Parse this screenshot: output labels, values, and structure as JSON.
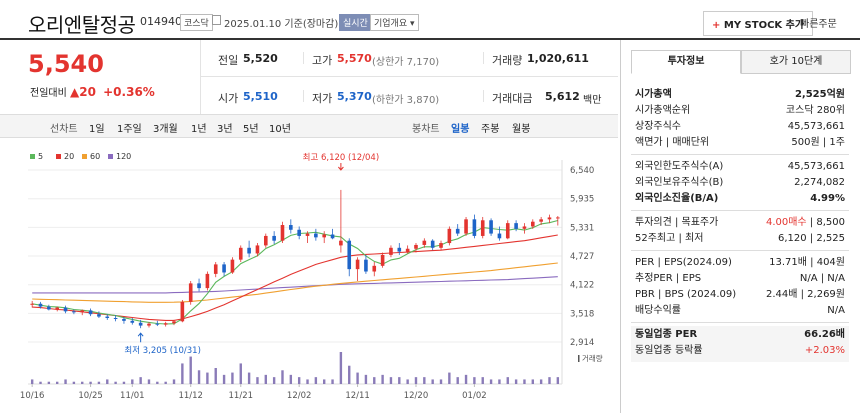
{
  "header": {
    "name": "오리엔탈정공",
    "code": "014940",
    "market": "코스닥",
    "date": "2025.01.10 기준(장마감)",
    "live": "실시간",
    "overview": "기업개요",
    "mystock": "MY STOCK 추가",
    "quick_order": "빠른주문"
  },
  "price": {
    "current": "5,540",
    "change_label": "전일대비",
    "change": "20",
    "change_pct": "+0.36%"
  },
  "quote": {
    "prev_label": "전일",
    "prev": "5,520",
    "high_label": "고가",
    "high": "5,570",
    "upper": "(상한가 7,170)",
    "volume_label": "거래량",
    "volume": "1,020,611",
    "open_label": "시가",
    "open": "5,510",
    "low_label": "저가",
    "low": "5,370",
    "lower": "(하한가 3,870)",
    "amount_label": "거래대금",
    "amount": "5,612",
    "amount_unit": "백만"
  },
  "periods": {
    "line_label": "선차트",
    "items": [
      "1일",
      "1주일",
      "3개월",
      "1년",
      "3년",
      "5년",
      "10년"
    ],
    "candle_label": "봉차트",
    "candle_items": [
      "일봉",
      "주봉",
      "월봉"
    ],
    "active": "일봉"
  },
  "chart_data": {
    "type": "candlestick",
    "legend": [
      "5",
      "20",
      "60",
      "120"
    ],
    "legend_colors": [
      "#5cb85c",
      "#e3342f",
      "#f0a030",
      "#8a6bbf"
    ],
    "yticks": [
      "6,540",
      "5,935",
      "5,331",
      "4,727",
      "4,122",
      "3,518",
      "2,914"
    ],
    "ylim": [
      2914,
      6540
    ],
    "xticks": [
      "10/16",
      "10/25",
      "11/01",
      "11/12",
      "11/21",
      "12/02",
      "12/11",
      "12/20",
      "01/02"
    ],
    "annotation_high": "최고 6,120 (12/04)",
    "annotation_low": "최저 3,205 (10/31)",
    "volume_label": "거래량",
    "candles": [
      [
        3700,
        3780,
        3640,
        3720
      ],
      [
        3720,
        3760,
        3620,
        3660
      ],
      [
        3660,
        3700,
        3580,
        3600
      ],
      [
        3600,
        3660,
        3560,
        3640
      ],
      [
        3640,
        3680,
        3520,
        3560
      ],
      [
        3560,
        3600,
        3500,
        3540
      ],
      [
        3540,
        3600,
        3480,
        3580
      ],
      [
        3580,
        3620,
        3460,
        3500
      ],
      [
        3500,
        3560,
        3420,
        3450
      ],
      [
        3450,
        3500,
        3380,
        3420
      ],
      [
        3420,
        3480,
        3350,
        3400
      ],
      [
        3400,
        3440,
        3300,
        3360
      ],
      [
        3360,
        3420,
        3280,
        3320
      ],
      [
        3320,
        3380,
        3205,
        3260
      ],
      [
        3260,
        3330,
        3220,
        3300
      ],
      [
        3300,
        3360,
        3250,
        3280
      ],
      [
        3280,
        3340,
        3240,
        3310
      ],
      [
        3310,
        3380,
        3270,
        3350
      ],
      [
        3350,
        3800,
        3330,
        3760
      ],
      [
        3760,
        4200,
        3700,
        4150
      ],
      [
        4150,
        4250,
        3980,
        4050
      ],
      [
        4050,
        4400,
        4000,
        4350
      ],
      [
        4350,
        4600,
        4280,
        4550
      ],
      [
        4550,
        4600,
        4300,
        4380
      ],
      [
        4380,
        4700,
        4350,
        4650
      ],
      [
        4650,
        4950,
        4600,
        4900
      ],
      [
        4900,
        5050,
        4700,
        4780
      ],
      [
        4780,
        5000,
        4720,
        4950
      ],
      [
        4950,
        5200,
        4900,
        5150
      ],
      [
        5150,
        5250,
        4980,
        5050
      ],
      [
        5050,
        5450,
        5000,
        5380
      ],
      [
        5380,
        5500,
        5200,
        5280
      ],
      [
        5280,
        5350,
        5080,
        5150
      ],
      [
        5150,
        5250,
        5000,
        5200
      ],
      [
        5200,
        5300,
        5050,
        5120
      ],
      [
        5120,
        5250,
        5000,
        5180
      ],
      [
        5180,
        5300,
        5080,
        5100
      ],
      [
        4950,
        6120,
        4800,
        5050
      ],
      [
        5050,
        5100,
        4300,
        4450
      ],
      [
        4450,
        4700,
        4200,
        4650
      ],
      [
        4650,
        4750,
        4350,
        4400
      ],
      [
        4400,
        4600,
        4300,
        4520
      ],
      [
        4520,
        4800,
        4480,
        4750
      ],
      [
        4750,
        4950,
        4700,
        4900
      ],
      [
        4900,
        5000,
        4750,
        4820
      ],
      [
        4820,
        4950,
        4780,
        4880
      ],
      [
        4880,
        5000,
        4800,
        4960
      ],
      [
        4960,
        5100,
        4900,
        5050
      ],
      [
        5050,
        5080,
        4850,
        4900
      ],
      [
        4900,
        5050,
        4850,
        5000
      ],
      [
        5000,
        5350,
        4950,
        5300
      ],
      [
        5300,
        5400,
        5150,
        5200
      ],
      [
        5200,
        5550,
        5150,
        5500
      ],
      [
        5500,
        5600,
        5100,
        5150
      ],
      [
        5150,
        5550,
        5100,
        5480
      ],
      [
        5480,
        5520,
        5150,
        5200
      ],
      [
        5200,
        5350,
        5050,
        5100
      ],
      [
        5100,
        5480,
        5080,
        5420
      ],
      [
        5420,
        5480,
        5250,
        5300
      ],
      [
        5300,
        5420,
        5200,
        5350
      ],
      [
        5350,
        5500,
        5300,
        5450
      ],
      [
        5450,
        5550,
        5380,
        5500
      ],
      [
        5500,
        5600,
        5420,
        5540
      ],
      [
        5520,
        5570,
        5370,
        5540
      ]
    ],
    "volume": [
      2,
      1,
      1,
      1,
      2,
      1,
      1,
      1,
      1,
      2,
      1,
      1,
      2,
      3,
      2,
      1,
      1,
      2,
      9,
      12,
      6,
      5,
      7,
      4,
      5,
      9,
      5,
      3,
      4,
      3,
      6,
      4,
      3,
      2,
      3,
      2,
      2,
      14,
      8,
      5,
      4,
      3,
      4,
      3,
      3,
      2,
      3,
      3,
      2,
      2,
      5,
      3,
      4,
      3,
      3,
      2,
      2,
      3,
      2,
      2,
      2,
      2,
      3,
      3
    ],
    "ma20": [
      3650,
      3640,
      3620,
      3600,
      3590,
      3570,
      3550,
      3530,
      3510,
      3490,
      3470,
      3450,
      3430,
      3410,
      3390,
      3380,
      3370,
      3370,
      3400,
      3450,
      3500,
      3560,
      3630,
      3700,
      3780,
      3860,
      3940,
      4020,
      4100,
      4180,
      4260,
      4340,
      4410,
      4480,
      4550,
      4600,
      4650,
      4700,
      4730,
      4750,
      4760,
      4770,
      4780,
      4790,
      4800,
      4810,
      4820,
      4830,
      4840,
      4850,
      4870,
      4890,
      4910,
      4930,
      4950,
      4970,
      4990,
      5010,
      5030,
      5050,
      5080,
      5110,
      5140,
      5170
    ],
    "ma60": [
      3820,
      3815,
      3810,
      3805,
      3800,
      3795,
      3790,
      3785,
      3780,
      3775,
      3770,
      3765,
      3760,
      3755,
      3750,
      3750,
      3750,
      3752,
      3760,
      3770,
      3785,
      3800,
      3820,
      3840,
      3860,
      3880,
      3900,
      3920,
      3945,
      3970,
      3995,
      4020,
      4045,
      4070,
      4090,
      4110,
      4130,
      4150,
      4165,
      4180,
      4195,
      4210,
      4225,
      4240,
      4255,
      4270,
      4285,
      4300,
      4315,
      4330,
      4345,
      4360,
      4375,
      4390,
      4405,
      4420,
      4440,
      4460,
      4480,
      4500,
      4520,
      4540,
      4560,
      4580
    ],
    "ma120": [
      3950,
      3950,
      3950,
      3950,
      3950,
      3950,
      3950,
      3950,
      3950,
      3950,
      3950,
      3950,
      3950,
      3950,
      3950,
      3950,
      3950,
      3955,
      3960,
      3965,
      3970,
      3975,
      3980,
      3990,
      4000,
      4010,
      4020,
      4030,
      4040,
      4050,
      4060,
      4070,
      4080,
      4090,
      4100,
      4110,
      4120,
      4130,
      4135,
      4140,
      4145,
      4150,
      4155,
      4160,
      4165,
      4170,
      4175,
      4180,
      4185,
      4190,
      4195,
      4200,
      4205,
      4210,
      4215,
      4220,
      4225,
      4230,
      4240,
      4250,
      4260,
      4270,
      4280,
      4290
    ]
  },
  "side": {
    "tabs": [
      "투자정보",
      "호가 10단계"
    ],
    "rows1": [
      {
        "k": "시가총액",
        "v": "2,525억원"
      },
      {
        "k": "시가총액순위",
        "v": "코스닥 280위"
      },
      {
        "k": "상장주식수",
        "v": "45,573,661"
      },
      {
        "k": "액면가 | 매매단위",
        "v": "500원 | 1주"
      }
    ],
    "rows2": [
      {
        "k": "외국인한도주식수(A)",
        "v": "45,573,661"
      },
      {
        "k": "외국인보유주식수(B)",
        "v": "2,274,082"
      },
      {
        "k": "외국인소진율(B/A)",
        "v": "4.99%"
      }
    ],
    "rows3": [
      {
        "k": "투자의견 | 목표주가",
        "v1": "4.00매수",
        "v2": "8,500"
      },
      {
        "k": "52주최고 | 최저",
        "v1": "6,120",
        "v2": "2,525"
      }
    ],
    "rows4": [
      {
        "k": "PER | EPS(2024.09)",
        "v": "13.71배 | 404원"
      },
      {
        "k": "추정PER | EPS",
        "v": "N/A | N/A"
      },
      {
        "k": "PBR | BPS (2024.09)",
        "v": "2.44배 | 2,269원"
      },
      {
        "k": "배당수익률",
        "v": "N/A"
      }
    ],
    "rows5": [
      {
        "k": "동일업종 PER",
        "v": "66.26배"
      },
      {
        "k": "동일업종 등락률",
        "v": "+2.03%"
      }
    ]
  }
}
